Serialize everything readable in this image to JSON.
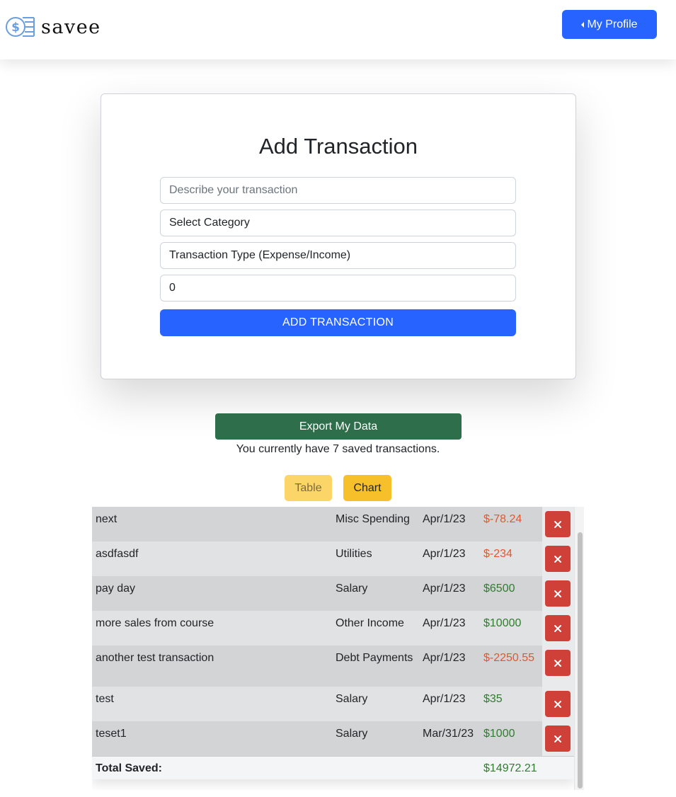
{
  "header": {
    "brand": "savee",
    "profile_label": "My Profile"
  },
  "form": {
    "title": "Add Transaction",
    "description_placeholder": "Describe your transaction",
    "category_select": "Select Category",
    "type_select": "Transaction Type (Expense/Income)",
    "amount_value": "0",
    "submit_label": "ADD TRANSACTION"
  },
  "export": {
    "label": "Export My Data",
    "saved_text": "You currently have 7 saved transactions."
  },
  "view_toggle": {
    "table_label": "Table",
    "chart_label": "Chart"
  },
  "transactions": [
    {
      "description": "next",
      "category": "Misc Spending",
      "date": "Apr/1/23",
      "amount": "$-78.24",
      "sign": "negative"
    },
    {
      "description": "asdfasdf",
      "category": "Utilities",
      "date": "Apr/1/23",
      "amount": "$-234",
      "sign": "negative"
    },
    {
      "description": "pay day",
      "category": "Salary",
      "date": "Apr/1/23",
      "amount": "$6500",
      "sign": "positive"
    },
    {
      "description": "more sales from course",
      "category": "Other Income",
      "date": "Apr/1/23",
      "amount": "$10000",
      "sign": "positive"
    },
    {
      "description": "another test transaction",
      "category": "Debt Payments",
      "date": "Apr/1/23",
      "amount": "$-2250.55",
      "sign": "negative"
    },
    {
      "description": "test",
      "category": "Salary",
      "date": "Apr/1/23",
      "amount": "$35",
      "sign": "positive"
    },
    {
      "description": "teset1",
      "category": "Salary",
      "date": "Mar/31/23",
      "amount": "$1000",
      "sign": "positive"
    }
  ],
  "total": {
    "label": "Total Saved:",
    "amount": "$14972.21"
  },
  "colors": {
    "primary": "#2764ff",
    "export": "#2f6e4b",
    "negative": "#e2572f",
    "positive": "#2f7d2e",
    "delete": "#cf4138",
    "table_toggle": "#fbd567",
    "chart_toggle": "#f7bf2a"
  }
}
